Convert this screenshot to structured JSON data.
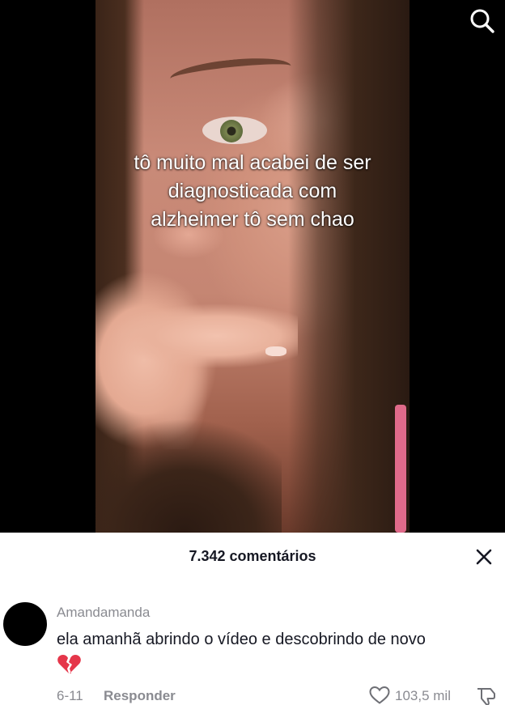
{
  "video": {
    "caption_line1": "tô muito mal acabei de ser",
    "caption_line2": "diagnosticada com",
    "caption_line3": "alzheimer tô sem chao",
    "search_icon": "search-icon"
  },
  "comments": {
    "count_label": "7.342 comentários",
    "close_icon": "close-icon",
    "items": [
      {
        "username": "Amandamanda",
        "text": "ela amanhã abrindo o vídeo e descobrindo de novo",
        "emoji": "💔",
        "emoji_icon": "broken-heart-icon",
        "date": "6-11",
        "reply_label": "Responder",
        "like_count": "103,5 mil",
        "like_icon": "heart-outline-icon",
        "dislike_icon": "thumbs-down-icon"
      }
    ]
  },
  "colors": {
    "sheet_background": "#ffffff",
    "primary_text": "#161823",
    "secondary_text": "#8a8b91",
    "broken_heart": "#e5364a"
  }
}
